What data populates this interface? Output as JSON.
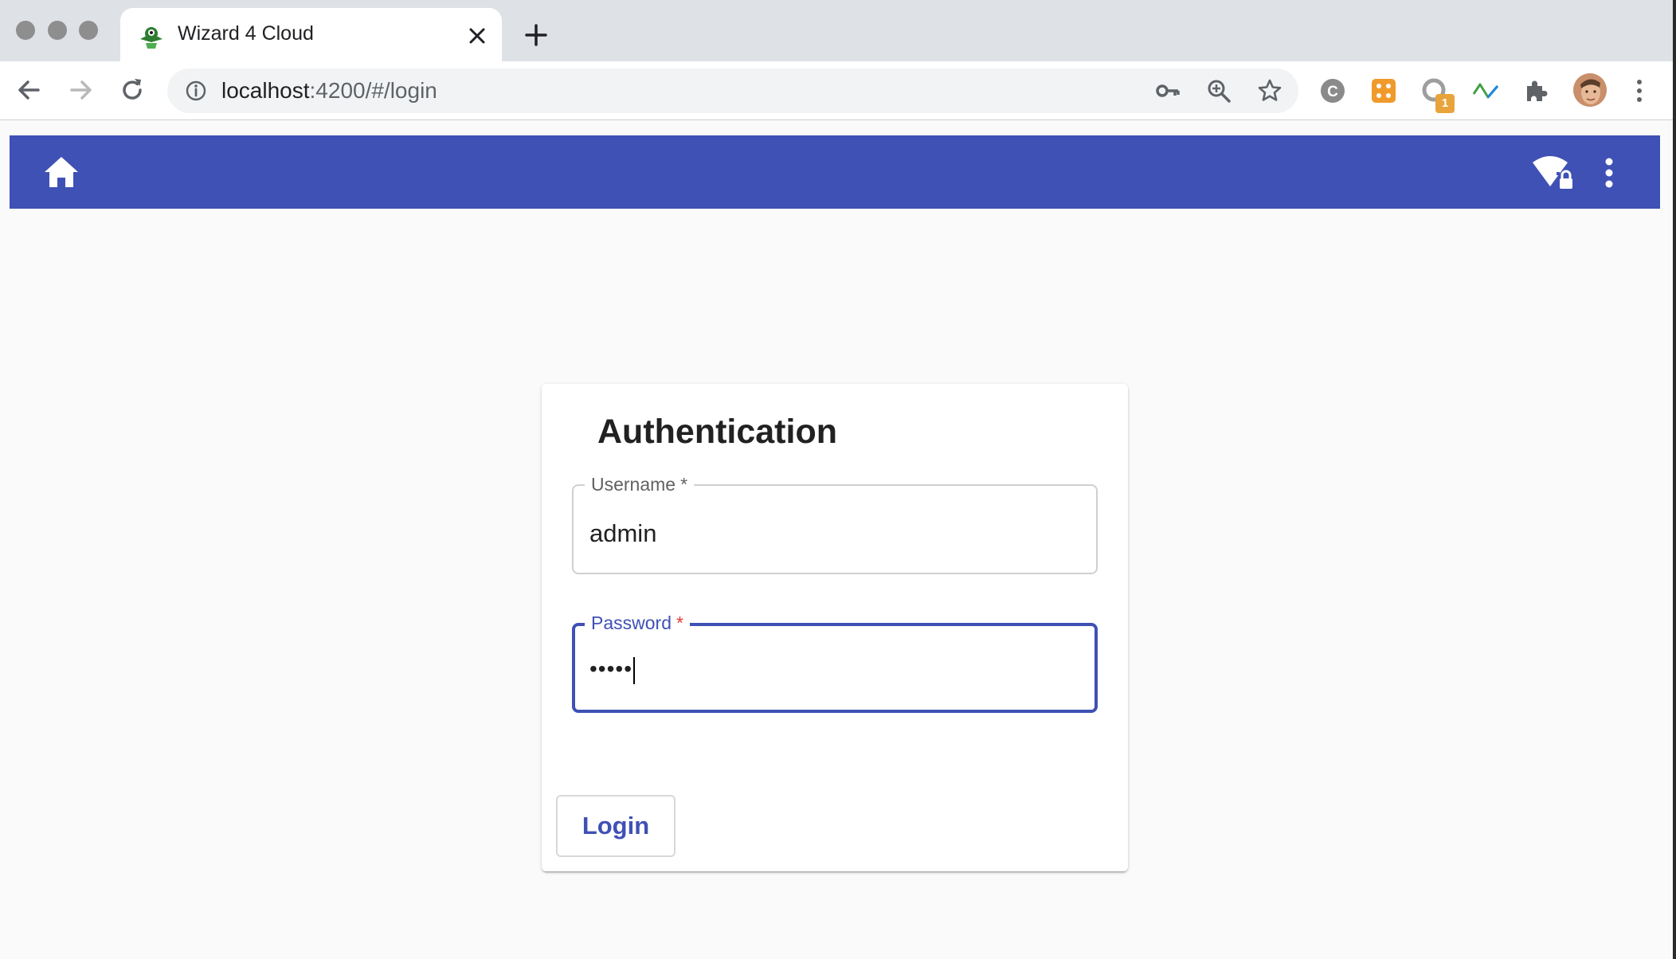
{
  "browser": {
    "tab_title": "Wizard 4 Cloud",
    "url_host": "localhost",
    "url_path": ":4200/#/login",
    "extension_badge": "1"
  },
  "app": {
    "accent_color": "#3f51b5",
    "appbar": {
      "left_icon": "home-icon",
      "right_icons": [
        "wifi-lock-icon",
        "more-vert-icon"
      ]
    }
  },
  "login_card": {
    "title": "Authentication",
    "username": {
      "label": "Username",
      "required_mark": "*",
      "value": "admin"
    },
    "password": {
      "label": "Password",
      "required_mark": "*",
      "masked_value": "•••••"
    },
    "login_button": "Login"
  }
}
